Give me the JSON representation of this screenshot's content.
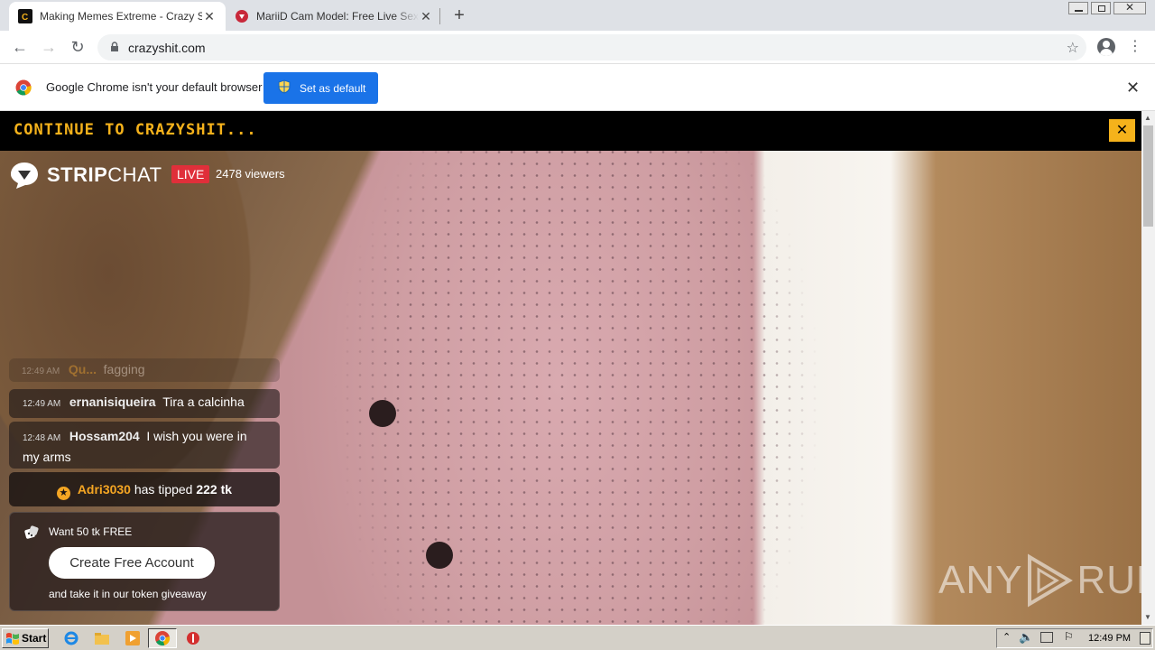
{
  "browser": {
    "tabs": [
      {
        "title": "Making Memes Extreme - Crazy Shit",
        "active": true
      },
      {
        "title": "MariiD Cam Model: Free Live Sex Show",
        "active": false
      }
    ],
    "url": "crazyshit.com",
    "infobar": {
      "text": "Google Chrome isn't your default browser",
      "button": "Set as default"
    }
  },
  "page": {
    "banner": "Continue to Crazyshit...",
    "banner_close": "✕",
    "brand": {
      "bold": "STRIP",
      "thin": "CHAT"
    },
    "live": "LIVE",
    "viewers": "2478 viewers",
    "chat": {
      "faded": {
        "time": "12:49 AM",
        "user": "Qu...",
        "msg": "fagging"
      },
      "messages": [
        {
          "time": "12:49 AM",
          "user": "ernanisiqueira",
          "msg": "Tira a calcinha"
        },
        {
          "time": "12:48 AM",
          "user": "Hossam204",
          "msg": "I wish you were in my arms"
        }
      ],
      "tip": {
        "user": "Adri3030",
        "text": "has tipped",
        "amount": "222 tk"
      }
    },
    "promo": {
      "title": "Want 50 tk FREE",
      "button": "Create Free Account",
      "subtitle": "and take it in our token giveaway"
    },
    "watermark": {
      "left": "ANY",
      "right": "RUN"
    }
  },
  "taskbar": {
    "start": "Start",
    "clock": "12:49 PM"
  },
  "colors": {
    "accent_yellow": "#f5b21b",
    "live_red": "#e02f3a",
    "tip_orange": "#f5a623",
    "chrome_blue": "#1a73e8"
  }
}
